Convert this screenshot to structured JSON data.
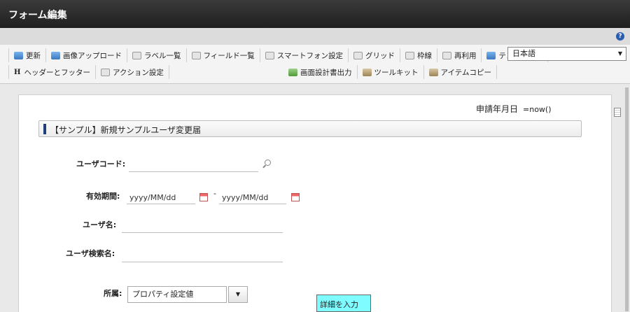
{
  "window": {
    "title": "フォーム編集"
  },
  "toolbar": {
    "row1": [
      {
        "name": "update-button",
        "icon": "update-icon",
        "label": "更新"
      },
      {
        "name": "image-upload-button",
        "icon": "image-upload-icon",
        "label": "画像アップロード"
      },
      {
        "name": "label-list-button",
        "icon": "label-list-icon",
        "label": "ラベル一覧"
      },
      {
        "name": "field-list-button",
        "icon": "field-list-icon",
        "label": "フィールド一覧"
      },
      {
        "name": "smartphone-settings-button",
        "icon": "smartphone-icon",
        "label": "スマートフォン設定"
      },
      {
        "name": "grid-button",
        "icon": "grid-icon",
        "label": "グリッド"
      },
      {
        "name": "border-button",
        "icon": "border-icon",
        "label": "枠線"
      },
      {
        "name": "reuse-button",
        "icon": "reuse-icon",
        "label": "再利用"
      },
      {
        "name": "template-button",
        "icon": "template-icon",
        "label": "テンプレート"
      }
    ],
    "row2_left": [
      {
        "name": "header-footer-button",
        "icon": "header-icon",
        "label": "ヘッダーとフッター"
      },
      {
        "name": "action-settings-button",
        "icon": "action-icon",
        "label": "アクション設定"
      }
    ],
    "row2_right": [
      {
        "name": "design-doc-output-button",
        "icon": "document-icon",
        "label": "画面設計書出力"
      },
      {
        "name": "toolkit-button",
        "icon": "toolkit-icon",
        "label": "ツールキット"
      },
      {
        "name": "item-copy-button",
        "icon": "copy-icon",
        "label": "アイテムコピー"
      }
    ],
    "language": "日本語"
  },
  "form": {
    "apply_date_label": "申請年月日",
    "apply_date_value": "=now()",
    "section_title": "【サンプル】新規サンプルユーザ変更届",
    "user_code_label": "ユーザコード:",
    "valid_period_label": "有効期間:",
    "date_from_placeholder": "yyyy/MM/dd",
    "date_separator": "-",
    "date_to_placeholder": "yyyy/MM/dd",
    "user_name_label": "ユーザ名:",
    "user_search_label": "ユーザ検索名:",
    "affiliation_label": "所属:",
    "affiliation_value": "プロパティ設定値",
    "detail_button": "詳細を入力"
  }
}
